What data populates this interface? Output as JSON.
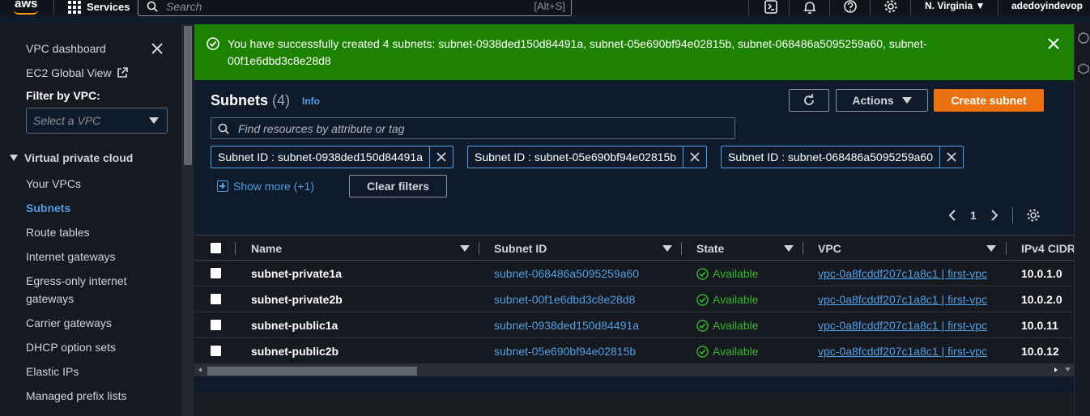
{
  "topnav": {
    "logo": "aws",
    "services_label": "Services",
    "search_placeholder": "Search",
    "search_shortcut": "[Alt+S]",
    "region": "N. Virginia",
    "user": "adedoyindevop",
    "icons": [
      "cloudshell-icon",
      "bell-icon",
      "help-icon",
      "gear-icon"
    ]
  },
  "sidebar": {
    "items_top": [
      {
        "label": "VPC dashboard"
      },
      {
        "label": "EC2 Global View"
      }
    ],
    "filter_label": "Filter by VPC:",
    "filter_placeholder": "Select a VPC",
    "section_label": "Virtual private cloud",
    "items": [
      {
        "label": "Your VPCs",
        "active": false
      },
      {
        "label": "Subnets",
        "active": true
      },
      {
        "label": "Route tables",
        "active": false
      },
      {
        "label": "Internet gateways",
        "active": false
      },
      {
        "label": "Egress-only internet",
        "active": false
      },
      {
        "label": "gateways",
        "active": false
      },
      {
        "label": "Carrier gateways",
        "active": false
      },
      {
        "label": "DHCP option sets",
        "active": false
      },
      {
        "label": "Elastic IPs",
        "active": false
      },
      {
        "label": "Managed prefix lists",
        "active": false
      }
    ]
  },
  "flash": {
    "message": "You have successfully created 4 subnets: subnet-0938ded150d84491a, subnet-05e690bf94e02815b, subnet-068486a5095259a60, subnet-00f1e6dbd3c8e28d8",
    "color": "#1d8102"
  },
  "header": {
    "title": "Subnets",
    "count": "(4)",
    "info": "Info",
    "actions_label": "Actions",
    "create_label": "Create subnet"
  },
  "filter": {
    "placeholder": "Find resources by attribute or tag",
    "tokens": [
      {
        "label": "Subnet ID : subnet-0938ded150d84491a"
      },
      {
        "label": "Subnet ID : subnet-05e690bf94e02815b"
      },
      {
        "label": "Subnet ID : subnet-068486a5095259a60"
      }
    ],
    "show_more": "Show more (+1)",
    "clear_label": "Clear filters"
  },
  "pagination": {
    "current_page": "1"
  },
  "table": {
    "columns": [
      "Name",
      "Subnet ID",
      "State",
      "VPC",
      "IPv4 CIDR"
    ],
    "rows": [
      {
        "name": "subnet-private1a",
        "subnet_id": "subnet-068486a5095259a60",
        "state": "Available",
        "vpc": "vpc-0a8fcddf207c1a8c1 | first-vpc",
        "cidr": "10.0.1.0"
      },
      {
        "name": "subnet-private2b",
        "subnet_id": "subnet-00f1e6dbd3c8e28d8",
        "state": "Available",
        "vpc": "vpc-0a8fcddf207c1a8c1 | first-vpc",
        "cidr": "10.0.2.0"
      },
      {
        "name": "subnet-public1a",
        "subnet_id": "subnet-0938ded150d84491a",
        "state": "Available",
        "vpc": "vpc-0a8fcddf207c1a8c1 | first-vpc",
        "cidr": "10.0.11"
      },
      {
        "name": "subnet-public2b",
        "subnet_id": "subnet-05e690bf94e02815b",
        "state": "Available",
        "vpc": "vpc-0a8fcddf207c1a8c1 | first-vpc",
        "cidr": "10.0.12"
      }
    ]
  },
  "colors": {
    "accent": "#539fe5",
    "primary_button": "#ec7211",
    "success": "#37b52e",
    "flash": "#1d8102"
  }
}
